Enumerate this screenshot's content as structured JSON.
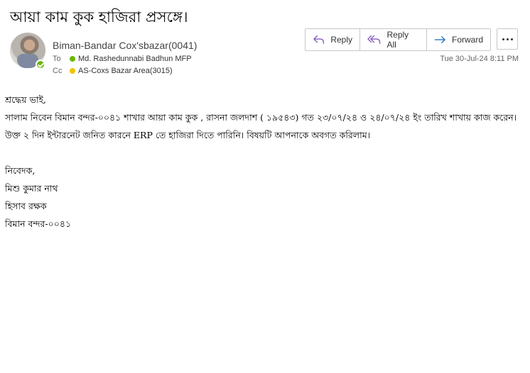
{
  "subject": "আয়া কাম কুক হাজিরা প্রসঙ্গে।",
  "sender": {
    "name": "Biman-Bandar Cox'sbazar(0041)",
    "avatar": "avatar-photo",
    "presence": "available"
  },
  "to": {
    "label": "To",
    "recipient": "Md. Rashedunnabi Badhun MFP",
    "status_color": "#6bb700"
  },
  "cc": {
    "label": "Cc",
    "recipient": "AS-Coxs Bazar Area(3015)",
    "status_color": "#f2c200"
  },
  "toolbar": {
    "reply_label": "Reply",
    "reply_icon": "reply-icon",
    "reply_all_label": "Reply All",
    "reply_all_icon": "reply-all-icon",
    "forward_label": "Forward",
    "forward_icon": "forward-icon",
    "more_icon": "more-options-icon"
  },
  "date": "Tue 30-Jul-24 8:11 PM",
  "body": {
    "greeting": "শ্রদ্ধেয় ভাই,",
    "line1": "সালাম নিবেন বিমান বন্দর-০০৪১ শাখার আয়া কাম কুক , রাসনা জলদাশ ( ১৯৫৪৩) গত ২৩/০৭/২৪ ও ২৪/০৭/২৪ ইং তারিখ শাখায় কাজ করেন।",
    "line2": "উক্ত ২ দিন ইন্টারনেট জনিত কারনে  ERP তে হাজিরা দিতে পারিনি। বিষয়টি আপনাকে অবগত করিলাম।",
    "sign_label": "নিবেদক,",
    "sign_name": "মিশু কুমার নাথ",
    "sign_title": "হিসাব রক্ষক",
    "sign_branch": "বিমান বন্দর-০০৪১"
  },
  "colors": {
    "accent": "#6bb700",
    "toolbar_border": "#c8c8c8",
    "icon_blue": "#1e6fc5",
    "icon_purple": "#8a5cc0"
  }
}
